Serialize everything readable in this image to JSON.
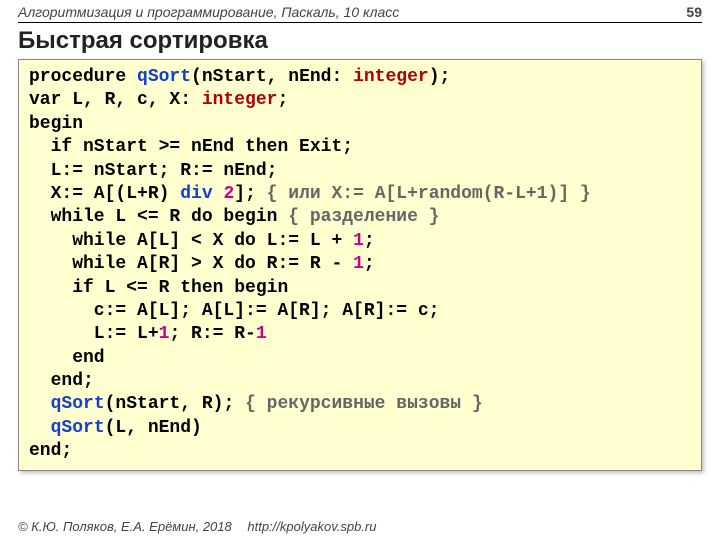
{
  "header": {
    "subject": "Алгоритмизация и программирование, Паскаль, 10 класс",
    "page": "59"
  },
  "title": "Быстрая сортировка",
  "code": {
    "l1_kw1": "procedure ",
    "l1_name": "qSort",
    "l1_args": "(nStart, nEnd: ",
    "l1_type": "integer",
    "l1_end": ");",
    "l2_a": "var L, R, c, X: ",
    "l2_b": "integer",
    "l2_c": ";",
    "l3": "begin",
    "l4": "  if nStart >= nEnd then Exit;",
    "l5": "  L:= nStart; R:= nEnd;",
    "l6_a": "  X:= A[(L+R) ",
    "l6_b": "div ",
    "l6_c": "2",
    "l6_d": "]; ",
    "l6_e": "{ или X:= A[L+random(R-L+1)] }",
    "l7_a": "  while L <= R do begin ",
    "l7_b": "{ разделение }",
    "l8_a": "    while A[L] < X do L:= L + ",
    "l8_b": "1",
    "l8_c": ";",
    "l9_a": "    while A[R] > X do R:= R - ",
    "l9_b": "1",
    "l9_c": ";",
    "l10": "    if L <= R then begin",
    "l11": "      c:= A[L]; A[L]:= A[R]; A[R]:= c;",
    "l12_a": "      L:= L+",
    "l12_b": "1",
    "l12_c": "; R:= R-",
    "l12_d": "1",
    "l13": "    end",
    "l14": "  end;",
    "l15_a": "  ",
    "l15_b": "qSort",
    "l15_c": "(nStart, R); ",
    "l15_d": "{ рекурсивные вызовы }",
    "l16_a": "  ",
    "l16_b": "qSort",
    "l16_c": "(L, nEnd)",
    "l17": "end;"
  },
  "footer": {
    "copyright": "© К.Ю. Поляков, Е.А. Ерёмин, 2018",
    "url": "http://kpolyakov.spb.ru"
  }
}
